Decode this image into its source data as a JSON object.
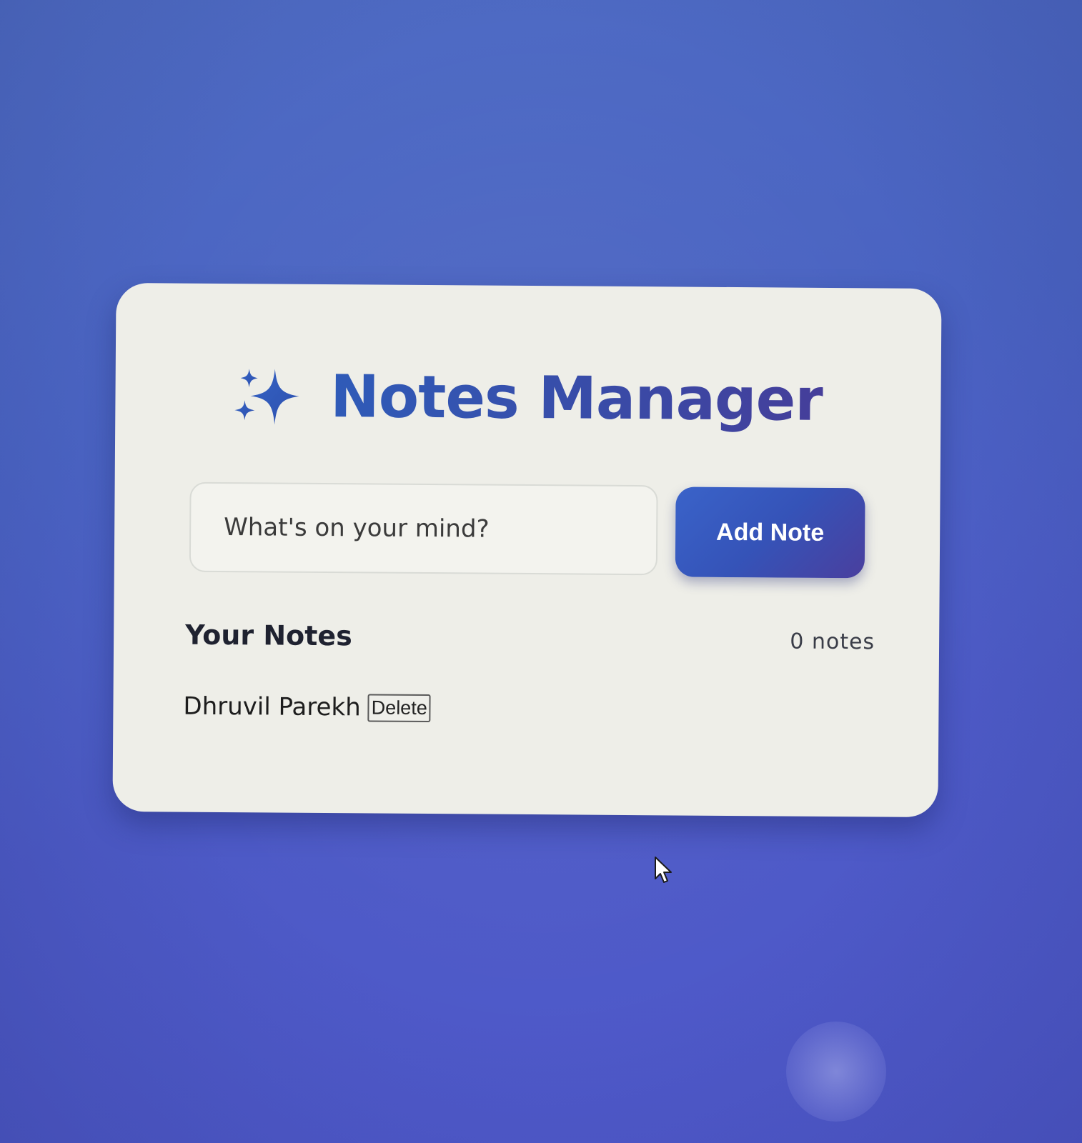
{
  "app": {
    "title": "Notes Manager",
    "title_icon": "sparkles-icon",
    "accent_color": "#2f4ea8"
  },
  "composer": {
    "placeholder": "What's on your mind?",
    "value": "",
    "add_button_label": "Add Note",
    "button_color": "#3553b8"
  },
  "notes_section": {
    "heading": "Your Notes",
    "count_label": "0 notes",
    "items": [
      {
        "text": "Dhruvil Parekh",
        "delete_label": "Delete"
      }
    ]
  },
  "background_color": "#4a63c2",
  "cursor_icon": "mouse-pointer-icon"
}
